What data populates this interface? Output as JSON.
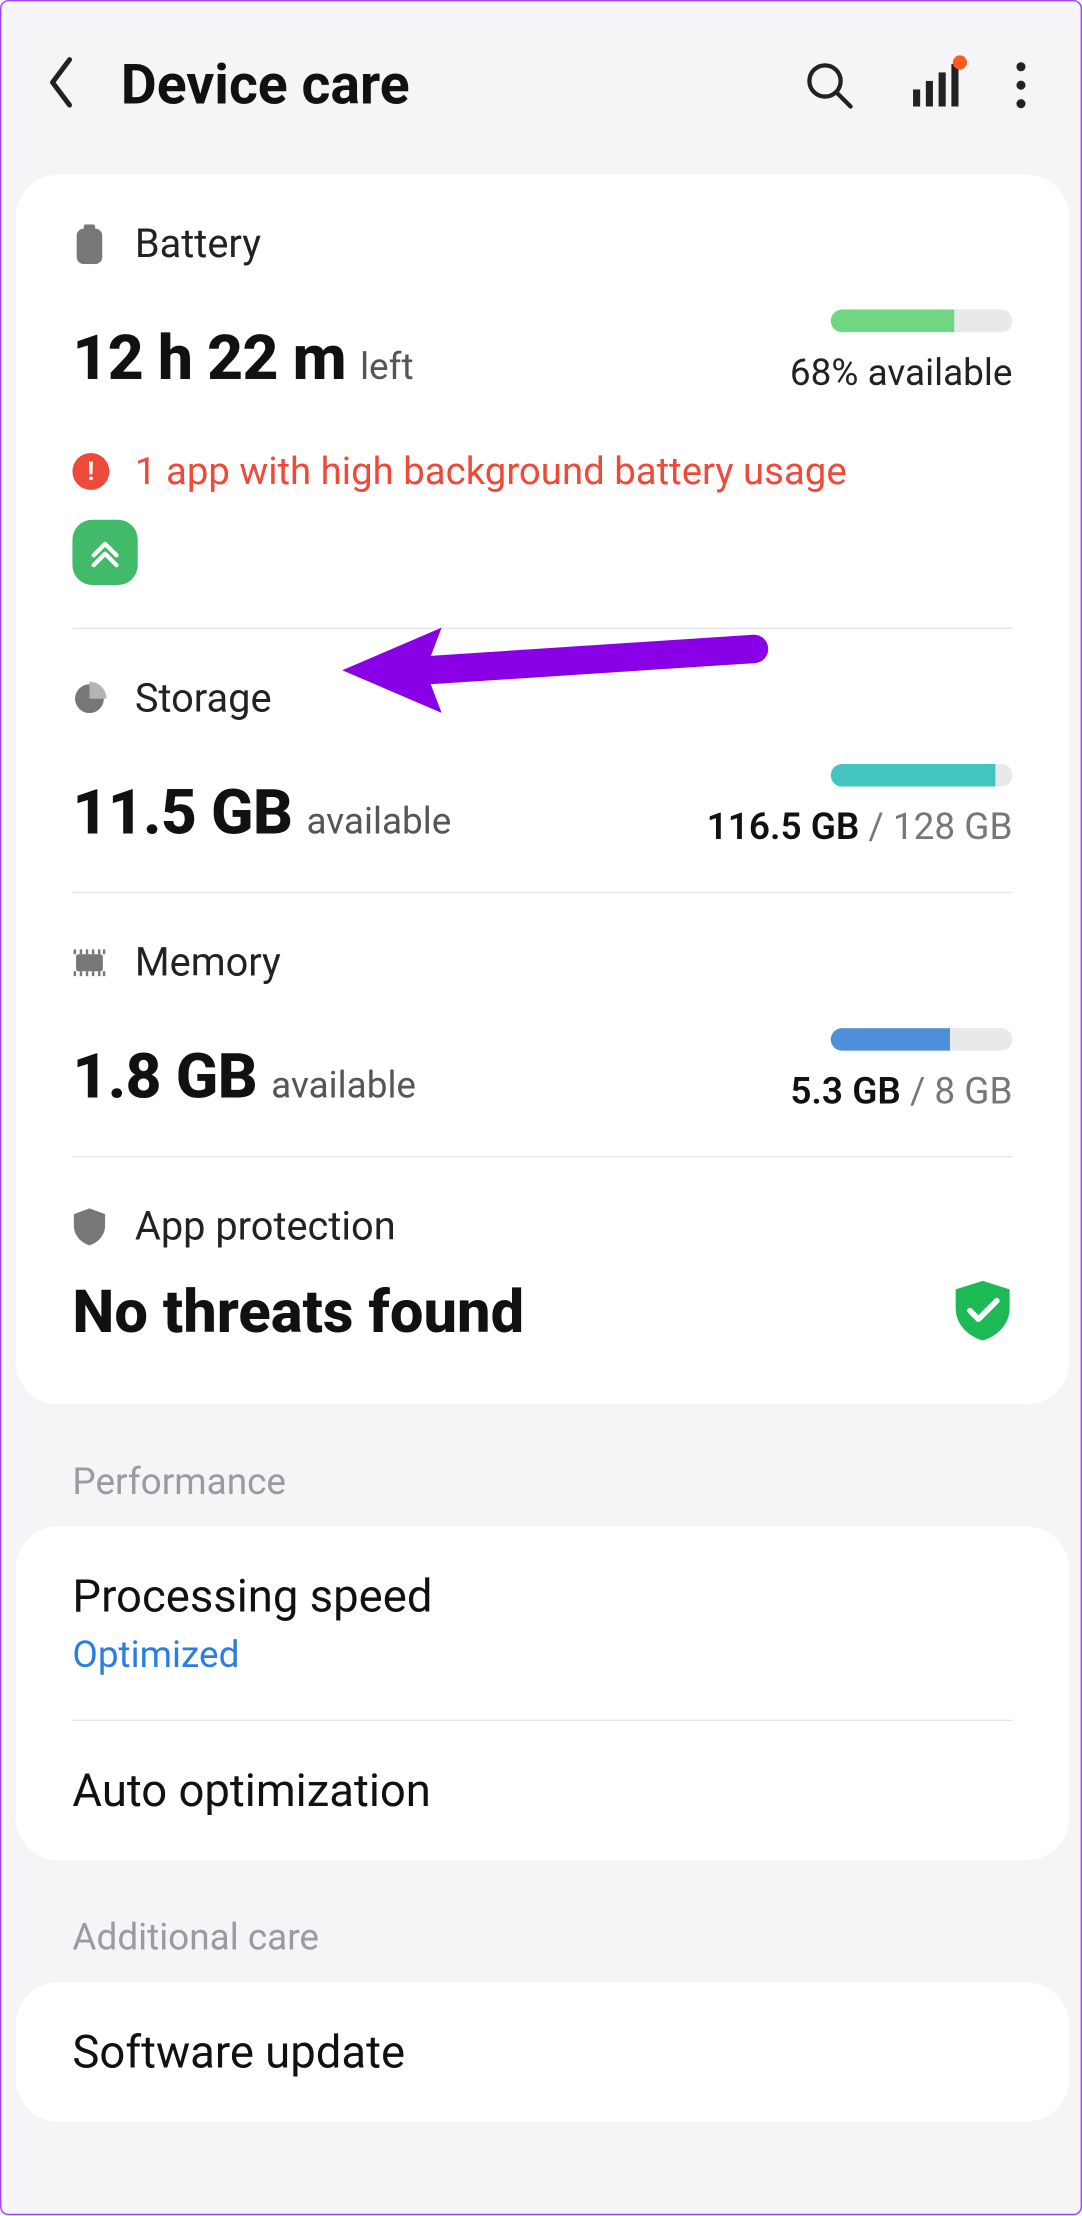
{
  "header": {
    "title": "Device care"
  },
  "battery": {
    "label": "Battery",
    "big": "12 h 22 m",
    "sub": "left",
    "percent_text": "68% available",
    "bar_pct": 68,
    "bar_color": "#6fd682",
    "warning": "1 app with high background battery usage"
  },
  "storage": {
    "label": "Storage",
    "big": "11.5 GB",
    "sub": "available",
    "used": "116.5 GB",
    "total": "128 GB",
    "bar_pct": 91,
    "bar_color": "#42c6bf"
  },
  "memory": {
    "label": "Memory",
    "big": "1.8 GB",
    "sub": "available",
    "used": "5.3 GB",
    "total": "8 GB",
    "bar_pct": 66,
    "bar_color": "#4f8fd9"
  },
  "protection": {
    "label": "App protection",
    "status": "No threats found"
  },
  "groups": {
    "performance": "Performance",
    "additional": "Additional care"
  },
  "performance": {
    "processing_title": "Processing speed",
    "processing_sub": "Optimized",
    "auto_opt": "Auto optimization"
  },
  "additional": {
    "software_update": "Software update"
  }
}
